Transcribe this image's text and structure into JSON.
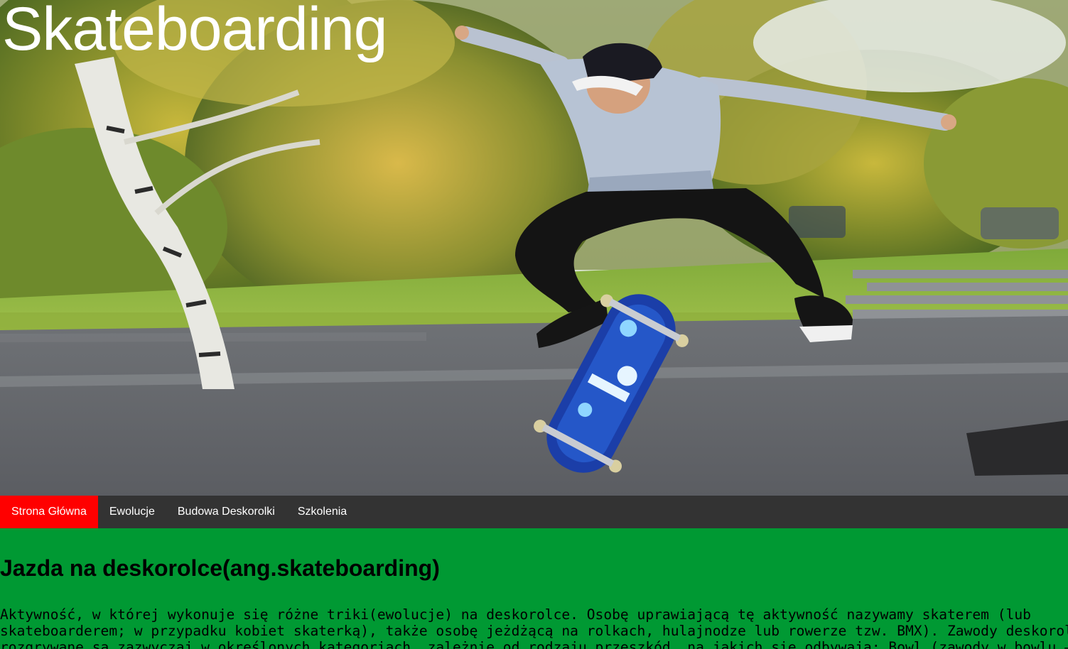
{
  "header": {
    "title": "Skateboarding",
    "image": "skateboarder-jump-photo"
  },
  "nav": {
    "items": [
      {
        "label": "Strona Główna",
        "active": true
      },
      {
        "label": "Ewolucje",
        "active": false
      },
      {
        "label": "Budowa Deskorolki",
        "active": false
      },
      {
        "label": "Szkolenia",
        "active": false
      }
    ]
  },
  "main": {
    "heading": "Jazda na deskorolce(ang.skateboarding)",
    "paragraph": "Aktywność, w której wykonuje się różne triki(ewolucje) na deskorolce. Osobę uprawiającą tę aktywność nazywamy skaterem (lub skateboarderem; w przypadku kobiet skaterką), także osobę jeżdżącą na rolkach, hulajnodze lub rowerze tzw. BMX). Zawody deskorolkowe rozgrywane są zazwyczaj w określonych kategoriach, zależnie od rodzaju przeszkód, na jakich się odbywają: Bowl (zawody w bowlu – w specjalnym betonowym wgłębieniu, przypominającym pusty basen), Vert (na drewnianych bądź betonowych rampach)"
  },
  "colors": {
    "page_background": "#009933",
    "nav_background": "#333333",
    "nav_active": "#ff0000",
    "nav_text": "#ffffff",
    "title_text": "#ffffff"
  }
}
